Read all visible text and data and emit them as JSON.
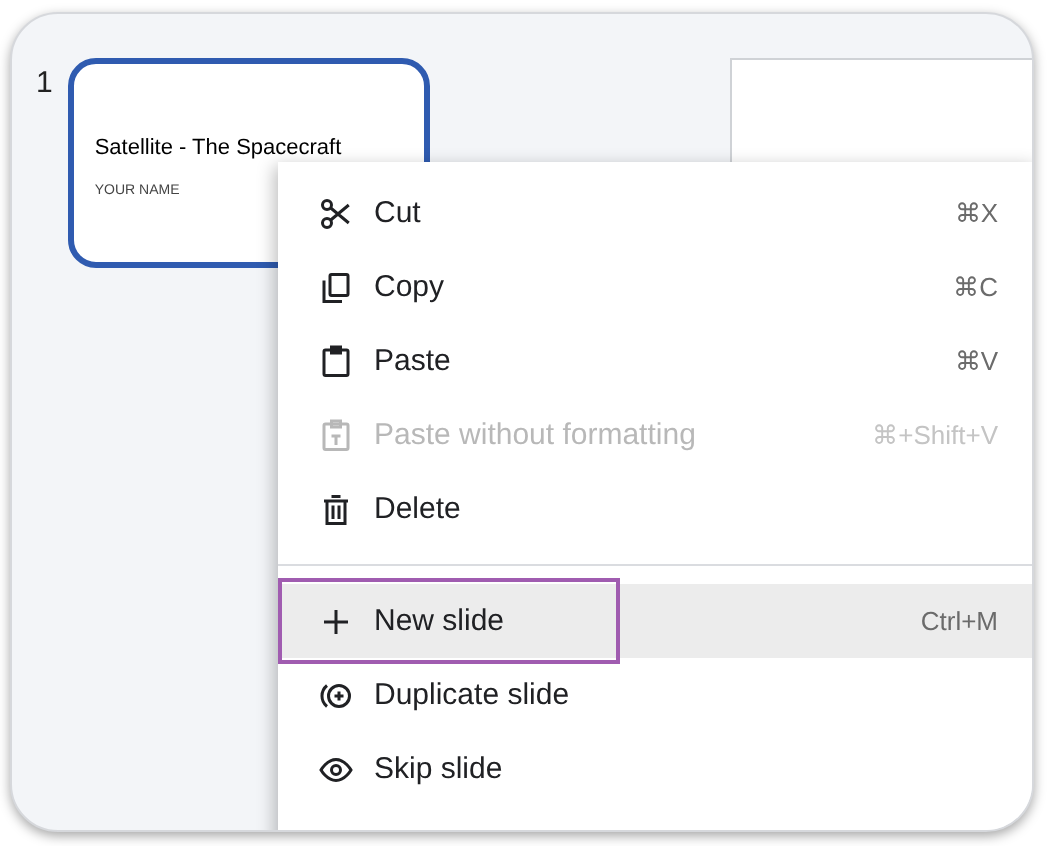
{
  "filmstrip": {
    "slide_number": "1",
    "thumbnail": {
      "title": "Satellite - The Spacecraft",
      "subtitle": "YOUR NAME",
      "selected": true
    }
  },
  "context_menu": [
    {
      "kind": "item",
      "label": "Cut",
      "shortcut": "⌘X",
      "disabled": false,
      "selected": false
    },
    {
      "kind": "item",
      "label": "Copy",
      "shortcut": "⌘C",
      "disabled": false,
      "selected": false
    },
    {
      "kind": "item",
      "label": "Paste",
      "shortcut": "⌘V",
      "disabled": false,
      "selected": false
    },
    {
      "kind": "item",
      "label": "Paste without formatting",
      "shortcut": "⌘+Shift+V",
      "disabled": true,
      "selected": false
    },
    {
      "kind": "item",
      "label": "Delete",
      "disabled": false,
      "selected": false
    },
    {
      "kind": "divider"
    },
    {
      "kind": "item",
      "label": "New slide",
      "shortcut": "Ctrl+M",
      "disabled": false,
      "selected": true
    },
    {
      "kind": "item",
      "label": "Duplicate slide",
      "disabled": false,
      "selected": false
    },
    {
      "kind": "item",
      "label": "Skip slide",
      "disabled": false,
      "selected": false
    }
  ]
}
